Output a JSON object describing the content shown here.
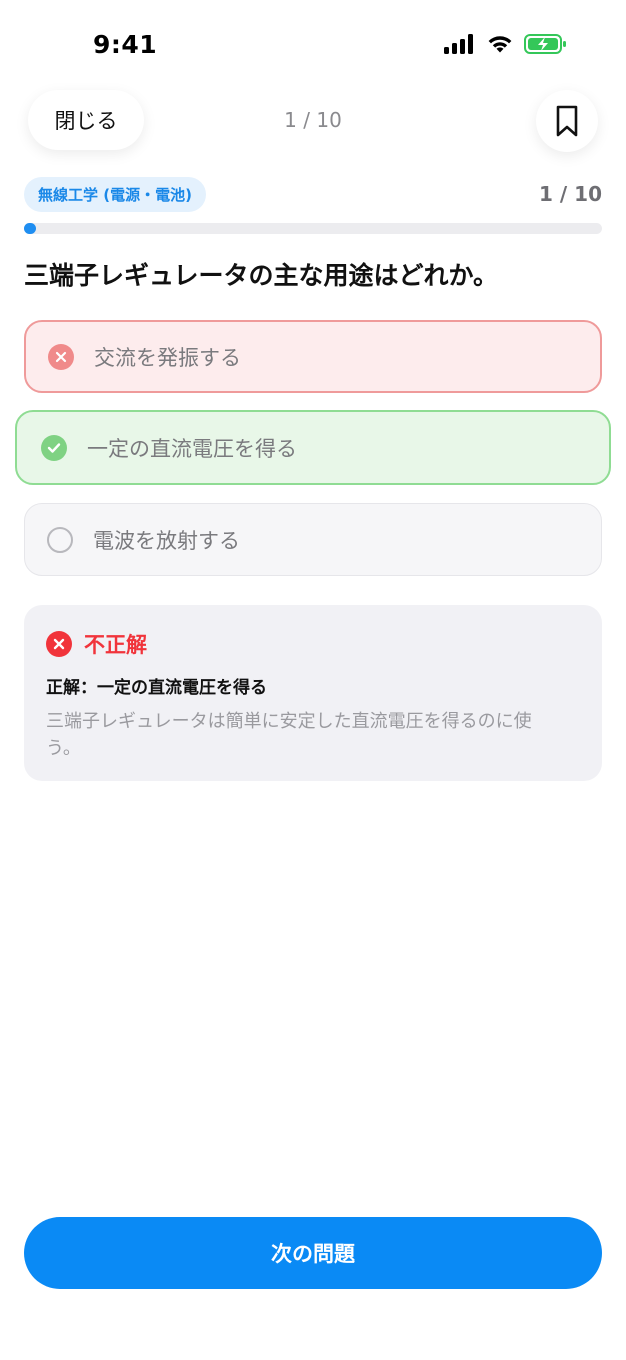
{
  "status_bar": {
    "time": "9:41"
  },
  "header": {
    "close_label": "閉じる",
    "counter": "1 / 10"
  },
  "quiz": {
    "category": "無線工学 (電源・電池)",
    "progress_text": "1 / 10",
    "progress_fraction": 0.02,
    "question": "三端子レギュレータの主な用途はどれか。",
    "options": [
      {
        "label": "交流を発振する",
        "state": "wrong"
      },
      {
        "label": "一定の直流電圧を得る",
        "state": "correct"
      },
      {
        "label": "電波を放射する",
        "state": "neutral"
      }
    ]
  },
  "feedback": {
    "title": "不正解",
    "answer": "正解：一定の直流電圧を得る",
    "explanation": "三端子レギュレータは簡単に安定した直流電圧を得るのに使う。"
  },
  "footer": {
    "next_label": "次の問題"
  },
  "colors": {
    "accent": "#0a8af5",
    "wrong": "#f1343b",
    "correct": "#7fd283"
  }
}
